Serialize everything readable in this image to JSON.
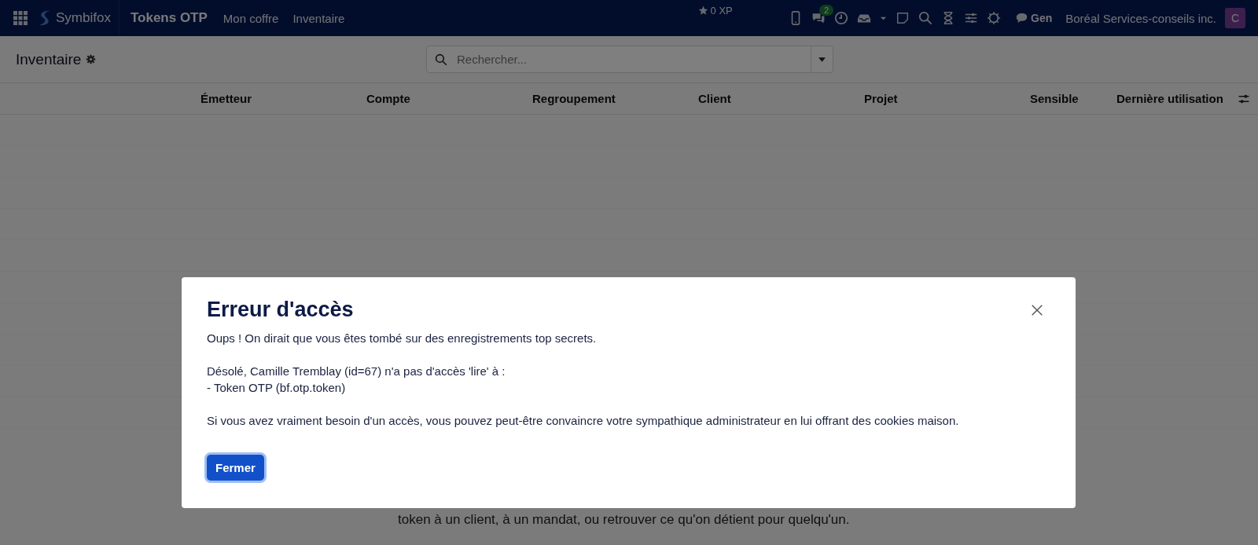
{
  "topbar": {
    "app_name": "Symbifox",
    "module": "Tokens OTP",
    "menu": [
      {
        "label": "Mon coffre"
      },
      {
        "label": "Inventaire"
      }
    ],
    "xp": "0 XP",
    "chat_badge": "2",
    "chat_channel": "Gen",
    "company": "Boréal Services-conseils inc.",
    "avatar_initial": "C"
  },
  "control_panel": {
    "title": "Inventaire",
    "search": {
      "placeholder": "Rechercher..."
    }
  },
  "table": {
    "columns": [
      "Émetteur",
      "Compte",
      "Regroupement",
      "Client",
      "Projet",
      "Sensible",
      "Dernière utilisation"
    ]
  },
  "background_text": "token à un client, à un mandat, ou retrouver ce qu'on détient pour quelqu'un.",
  "dialog": {
    "title": "Erreur d'accès",
    "paragraphs": [
      "Oups ! On dirait que vous êtes tombé sur des enregistrements top secrets.",
      "Désolé, Camille Tremblay (id=67) n'a pas d'accès 'lire' à :\n- Token OTP (bf.otp.token)",
      "Si vous avez vraiment besoin d'un accès, vous pouvez peut-être convaincre votre sympathique administrateur en lui offrant des cookies maison."
    ],
    "button": "Fermer"
  }
}
